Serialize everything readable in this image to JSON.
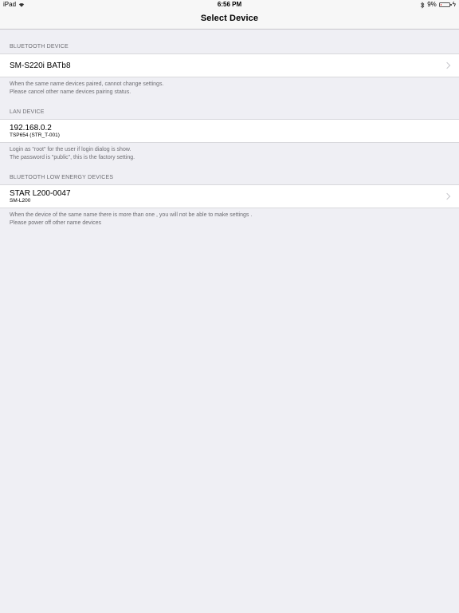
{
  "status_bar": {
    "device": "iPad",
    "time": "6:56 PM",
    "battery": "9%",
    "battery_level_percent": 9,
    "icons": [
      "wifi-icon",
      "bluetooth-icon",
      "battery-icon",
      "charging-icon"
    ]
  },
  "nav": {
    "title": "Select Device"
  },
  "sections": {
    "bluetooth": {
      "header": "BLUETOOTH DEVICE",
      "device_name": "SM-S220i BATb8",
      "footer_line1": "When the same name devices paired, cannot change settings.",
      "footer_line2": "Please cancel other name devices pairing status."
    },
    "lan": {
      "header": "LAN DEVICE",
      "ip": "192.168.0.2",
      "model": "TSP654 (STR_T-001)",
      "footer_line1": "Login as \"root\" for the user if login dialog is show.",
      "footer_line2": "The password is \"public\", this is the factory setting."
    },
    "ble": {
      "header": "BLUETOOTH LOW ENERGY DEVICES",
      "device_name": "STAR L200-0047",
      "model": "SM-L200",
      "footer_line1": "When the device of the same name there is more than one , you will not be able to make settings .",
      "footer_line2": "Please power off other name devices"
    }
  }
}
